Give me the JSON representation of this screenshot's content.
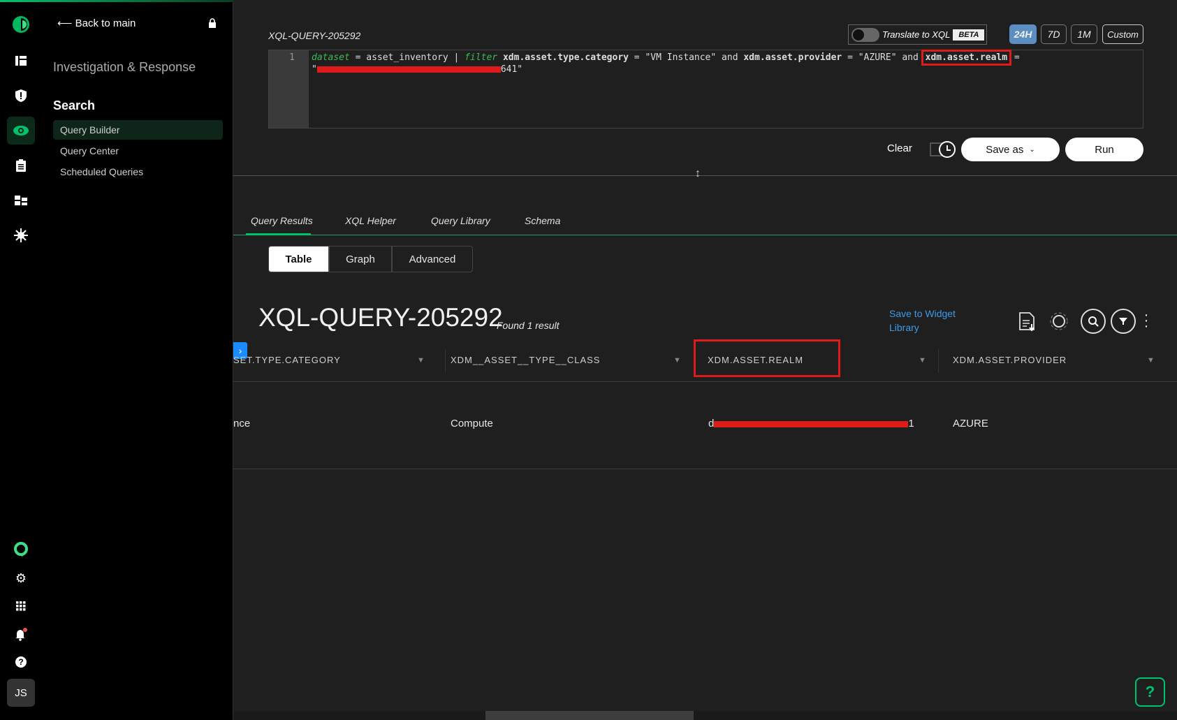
{
  "sidebar": {
    "back_label": "Back to main",
    "section_title": "Investigation & Response",
    "group_title": "Search",
    "items": [
      {
        "label": "Query Builder",
        "active": true
      },
      {
        "label": "Query Center"
      },
      {
        "label": "Scheduled Queries"
      }
    ],
    "avatar_initials": "JS"
  },
  "editor": {
    "query_name": "XQL-QUERY-205292",
    "line_number": "1",
    "tokens": {
      "kw1": "dataset",
      "t1": " = asset_inventory | ",
      "kw2": "filter",
      "f1": " xdm.asset.type.category",
      "t2": " = \"VM Instance\" and ",
      "f2": "xdm.asset.provider",
      "t3": " = \"AZURE\" and ",
      "f3": "xdm.asset.realm",
      "t4": " ="
    },
    "line2_start": "\"",
    "line2_end": "641\"",
    "translate_label": "Translate to XQL",
    "beta_label": "BETA",
    "time_ranges": [
      "24H",
      "7D",
      "1M",
      "Custom"
    ],
    "clear_label": "Clear",
    "save_as_label": "Save as",
    "run_label": "Run"
  },
  "results": {
    "tabs": [
      "Query Results",
      "XQL Helper",
      "Query Library",
      "Schema"
    ],
    "views": [
      "Table",
      "Graph",
      "Advanced"
    ],
    "title": "XQL-QUERY-205292",
    "found": "Found 1 result",
    "save_widget": "Save to Widget Library",
    "columns": [
      "SET.TYPE.CATEGORY",
      "XDM__ASSET__TYPE__CLASS",
      "XDM.ASSET.REALM",
      "XDM.ASSET.PROVIDER"
    ],
    "rows": [
      [
        "nce",
        "Compute",
        "d",
        "AZURE"
      ]
    ],
    "realm_suffix": "1"
  },
  "colors": {
    "accent": "#00c26a",
    "link": "#3c9be8",
    "highlight": "#e01b1b",
    "active_range": "#5b8fc2"
  }
}
